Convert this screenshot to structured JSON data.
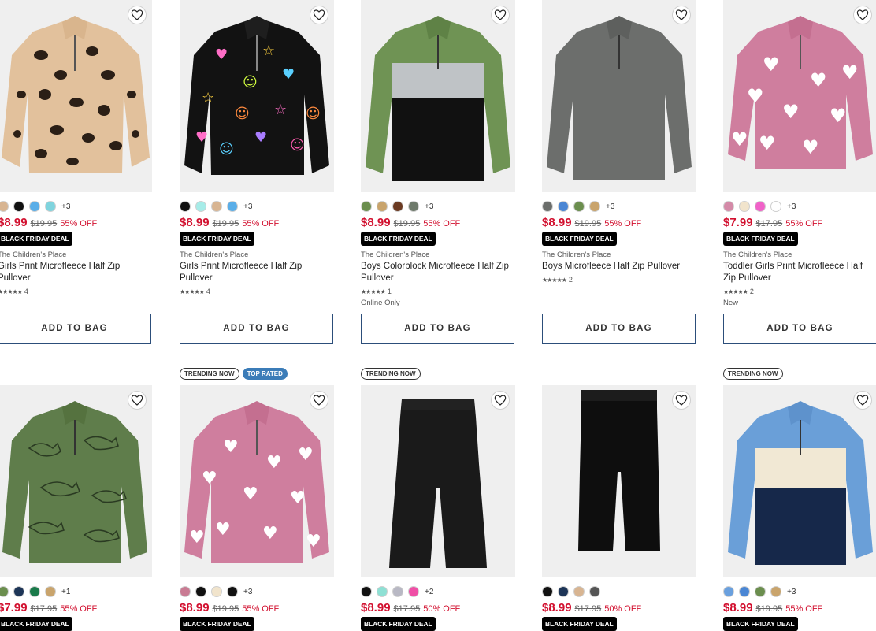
{
  "products": [
    {
      "id": "p1",
      "swatches": [
        "#d8b592",
        "#111111",
        "#5aaee8",
        "#7fd4de"
      ],
      "more_colors": "+3",
      "price": "$8.99",
      "was": "$19.95",
      "off": "55% OFF",
      "deal": "BLACK FRIDAY DEAL",
      "brand": "The Children's Place",
      "name": "Girls Print Microfleece Half Zip Pullover",
      "stars": "★★★★★",
      "review_count": "4",
      "extra": "",
      "add_label": "ADD TO BAG",
      "image": "leopard-fleece"
    },
    {
      "id": "p2",
      "swatches": [
        "#111111",
        "#a6ece8",
        "#d8b592",
        "#5aaee8"
      ],
      "more_colors": "+3",
      "price": "$8.99",
      "was": "$19.95",
      "off": "55% OFF",
      "deal": "BLACK FRIDAY DEAL",
      "brand": "The Children's Place",
      "name": "Girls Print Microfleece Half Zip Pullover",
      "stars": "★★★★★",
      "review_count": "4",
      "extra": "",
      "add_label": "ADD TO BAG",
      "image": "black-stars-fleece"
    },
    {
      "id": "p3",
      "swatches": [
        "#6b8e4e",
        "#c9a46c",
        "#6b3a22",
        "#6e7a6b"
      ],
      "more_colors": "+3",
      "price": "$8.99",
      "was": "$19.95",
      "off": "55% OFF",
      "deal": "BLACK FRIDAY DEAL",
      "brand": "The Children's Place",
      "name": "Boys Colorblock Microfleece Half Zip Pullover",
      "stars": "★★★★★",
      "review_count": "1",
      "extra": "Online Only",
      "add_label": "ADD TO BAG",
      "image": "green-colorblock-fleece"
    },
    {
      "id": "p4",
      "swatches": [
        "#6b6e6b",
        "#4a86d4",
        "#6b8e4e",
        "#c9a46c"
      ],
      "more_colors": "+3",
      "price": "$8.99",
      "was": "$19.95",
      "off": "55% OFF",
      "deal": "BLACK FRIDAY DEAL",
      "brand": "The Children's Place",
      "name": "Boys Microfleece Half Zip Pullover",
      "stars": "★★★★★",
      "review_count": "2",
      "extra": "",
      "add_label": "ADD TO BAG",
      "image": "gray-fleece"
    },
    {
      "id": "p5",
      "swatches": [
        "#d48aa8",
        "#f1e4cc",
        "#f062c8",
        "#ffffff"
      ],
      "more_colors": "+3",
      "price": "$7.99",
      "was": "$17.95",
      "off": "55% OFF",
      "deal": "BLACK FRIDAY DEAL",
      "brand": "The Children's Place",
      "name": "Toddler Girls Print Microfleece Half Zip Pullover",
      "stars": "★★★★★",
      "review_count": "2",
      "extra": "New",
      "add_label": "ADD TO BAG",
      "image": "pink-hearts-fleece"
    },
    {
      "id": "p6",
      "swatches": [
        "#6b8e4e",
        "#1d3557",
        "#1a7a4a",
        "#c9a46c"
      ],
      "more_colors": "+1",
      "price": "$7.99",
      "was": "$17.95",
      "off": "55% OFF",
      "deal": "BLACK FRIDAY DEAL",
      "badges": [],
      "image": "dino-fleece"
    },
    {
      "id": "p7",
      "swatches": [
        "#c97b93",
        "#111111",
        "#f1e4cc",
        "#111111"
      ],
      "more_colors": "+3",
      "price": "$8.99",
      "was": "$19.95",
      "off": "55% OFF",
      "deal": "BLACK FRIDAY DEAL",
      "badges": [
        "TRENDING NOW",
        "TOP RATED"
      ],
      "image": "pink-hearts-fleece-2"
    },
    {
      "id": "p8",
      "swatches": [
        "#111111",
        "#8ee0d4",
        "#b8b8c4",
        "#ef4fa6"
      ],
      "more_colors": "+2",
      "price": "$8.99",
      "was": "$17.95",
      "off": "50% OFF",
      "deal": "BLACK FRIDAY DEAL",
      "badges": [
        "TRENDING NOW"
      ],
      "image": "black-flare-pants"
    },
    {
      "id": "p9",
      "swatches": [
        "#111111",
        "#1d3557",
        "#d8b592",
        "#555555"
      ],
      "more_colors": "",
      "price": "$8.99",
      "was": "$17.95",
      "off": "50% OFF",
      "deal": "BLACK FRIDAY DEAL",
      "badges": [],
      "image": "black-pants"
    },
    {
      "id": "p10",
      "swatches": [
        "#6aa0de",
        "#4a86d4",
        "#6b8e4e",
        "#c9a46c"
      ],
      "more_colors": "+3",
      "price": "$8.99",
      "was": "$19.95",
      "off": "55% OFF",
      "deal": "BLACK FRIDAY DEAL",
      "badges": [
        "TRENDING NOW"
      ],
      "image": "blue-colorblock-fleece"
    }
  ],
  "colors": {
    "price_red": "#d2102f",
    "button_border": "#2c4e7a",
    "image_bg": "#efefef"
  },
  "icons": {
    "favorite": "heart-outline-icon"
  }
}
